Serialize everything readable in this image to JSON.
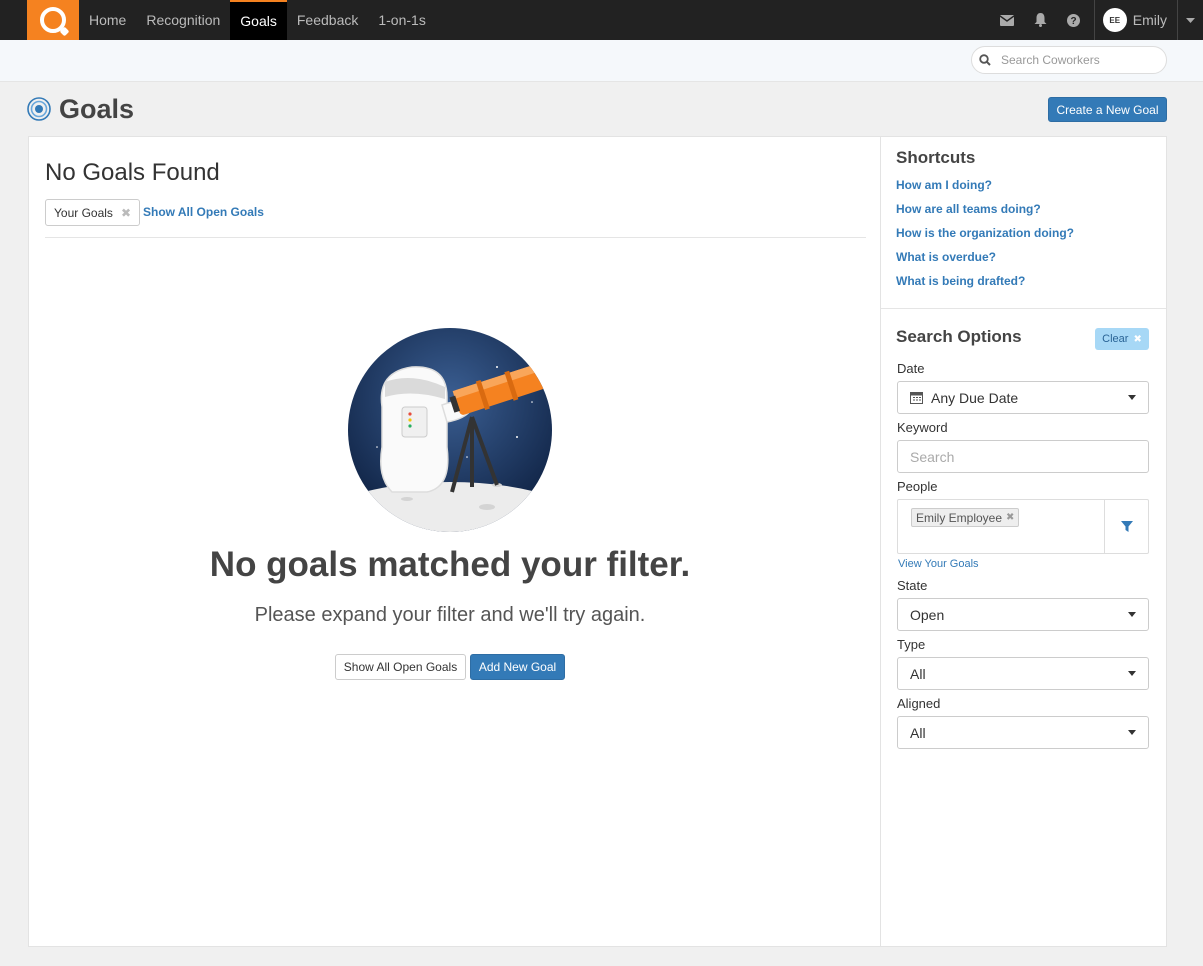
{
  "nav": {
    "items": [
      {
        "label": "Home",
        "active": false
      },
      {
        "label": "Recognition",
        "active": false
      },
      {
        "label": "Goals",
        "active": true
      },
      {
        "label": "Feedback",
        "active": false
      },
      {
        "label": "1-on-1s",
        "active": false
      }
    ],
    "user": {
      "initials": "EE",
      "name": "Emily"
    }
  },
  "subbar": {
    "search_placeholder": "Search Coworkers"
  },
  "header": {
    "title": "Goals",
    "create_button": "Create a New Goal"
  },
  "main": {
    "title": "No Goals Found",
    "filter_chip": "Your Goals",
    "show_all_link": "Show All Open Goals",
    "empty_heading": "No goals matched your filter.",
    "empty_text": "Please expand your filter and we'll try again.",
    "show_all_button": "Show All Open Goals",
    "add_button": "Add New Goal"
  },
  "shortcuts": {
    "title": "Shortcuts",
    "items": [
      "How am I doing?",
      "How are all teams doing?",
      "How is the organization doing?",
      "What is overdue?",
      "What is being drafted?"
    ]
  },
  "search_options": {
    "title": "Search Options",
    "clear_label": "Clear",
    "date_label": "Date",
    "date_value": "Any Due Date",
    "keyword_label": "Keyword",
    "keyword_placeholder": "Search",
    "people_label": "People",
    "people_tag": "Emily Employee",
    "view_your_goals": "View Your Goals",
    "state_label": "State",
    "state_value": "Open",
    "type_label": "Type",
    "type_value": "All",
    "aligned_label": "Aligned",
    "aligned_value": "All"
  },
  "colors": {
    "brand": "#f58220",
    "primary": "#337ab7",
    "nav_bg": "#222222"
  }
}
